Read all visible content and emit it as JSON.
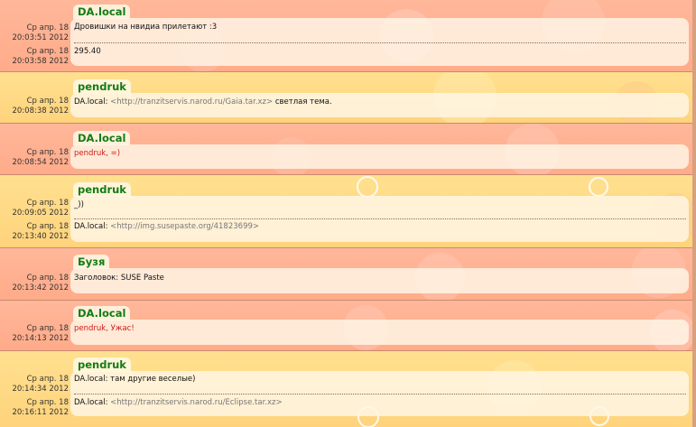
{
  "groups": [
    {
      "nick": "DA.local",
      "messages": [
        {
          "date": "Ср апр. 18",
          "time": "20:03:51 2012",
          "text": "Дровишки на нвидиа прилетают :3"
        },
        {
          "date": "Ср апр. 18",
          "time": "20:03:58 2012",
          "text": "295.40"
        }
      ]
    },
    {
      "nick": "pendruk",
      "messages": [
        {
          "date": "Ср апр. 18",
          "time": "20:08:38 2012",
          "prefix": "DA.local: ",
          "link": "<http://tranzitservis.narod.ru/Gaia.tar.xz>",
          "suffix": " светлая тема."
        }
      ]
    },
    {
      "nick": "DA.local",
      "messages": [
        {
          "date": "Ср апр. 18",
          "time": "20:08:54 2012",
          "text": "pendruk, =)"
        }
      ]
    },
    {
      "nick": "pendruk",
      "messages": [
        {
          "date": "Ср апр. 18",
          "time": "20:09:05 2012",
          "text": "_))"
        },
        {
          "date": "Ср апр. 18",
          "time": "20:13:40 2012",
          "prefix": "DA.local: ",
          "link": "<http://img.susepaste.org/41823699>",
          "suffix": ""
        }
      ]
    },
    {
      "nick": "Бузя",
      "messages": [
        {
          "date": "Ср апр. 18",
          "time": "20:13:42 2012",
          "text": "Заголовок: SUSE Paste"
        }
      ]
    },
    {
      "nick": "DA.local",
      "messages": [
        {
          "date": "Ср апр. 18",
          "time": "20:14:13 2012",
          "text": "pendruk, Ужас!"
        }
      ]
    },
    {
      "nick": "pendruk",
      "messages": [
        {
          "date": "Ср апр. 18",
          "time": "20:14:34 2012",
          "text": "DA.local: там другие веселые)"
        },
        {
          "date": "Ср апр. 18",
          "time": "20:16:11 2012",
          "prefix": "DA.local: ",
          "link": "<http://tranzitservis.narod.ru/Eclipse.tar.xz>",
          "suffix": ""
        }
      ]
    }
  ],
  "colors": {
    "nick": "#137d13",
    "highlight_text": "#d11a1a",
    "link_text": "#777777",
    "peach_band": "#ffb79a",
    "yellow_band": "#ffe08f"
  }
}
